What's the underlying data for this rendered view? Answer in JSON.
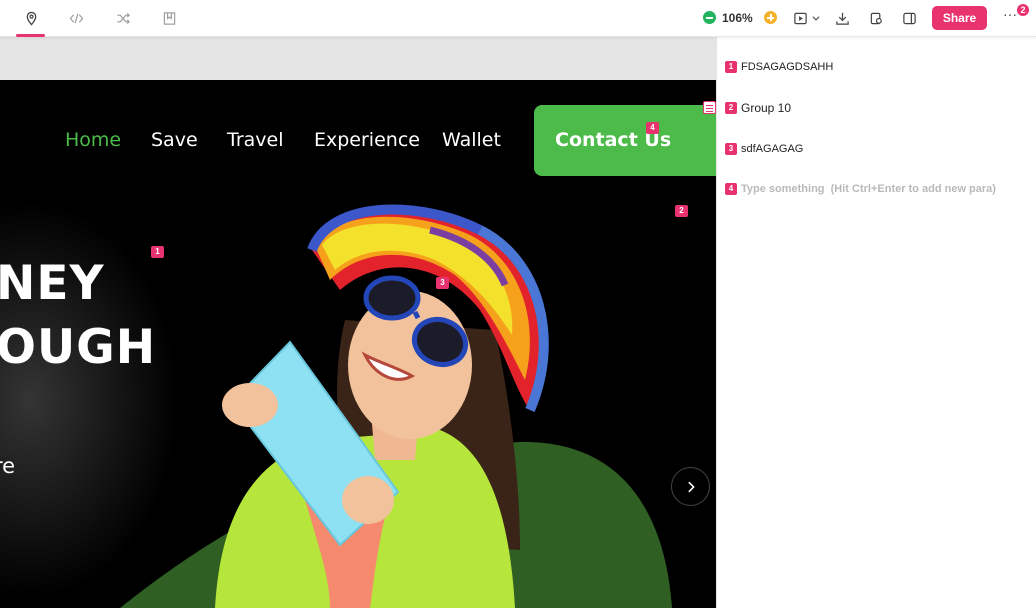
{
  "toolbar": {
    "tabs": [
      {
        "icon": "location-pin-icon"
      },
      {
        "icon": "code-icon"
      },
      {
        "icon": "shuffle-icon"
      },
      {
        "icon": "bookmark-icon"
      }
    ],
    "zoom": "106%",
    "share_label": "Share",
    "more_label": "···",
    "notification_count": "2",
    "accent": "#e8336f"
  },
  "website": {
    "nav": [
      "Home",
      "Save",
      "Travel",
      "Experience",
      "Wallet"
    ],
    "contact_label": "Contact Us",
    "hero_lines": [
      "NEY",
      "OUGH"
    ],
    "hero_sub": "re",
    "brand_green": "#4cbb4a"
  },
  "markers": [
    "1",
    "2",
    "3",
    "4"
  ],
  "comments": [
    {
      "num": "1",
      "text": "FDSAGAGDSAHH"
    },
    {
      "num": "2",
      "text": "Group 10"
    },
    {
      "num": "3",
      "text": "sdfAGAGAG"
    }
  ],
  "new_comment": {
    "num": "4",
    "placeholder": "Type something  (Hit Ctrl+Enter to add new para)"
  }
}
